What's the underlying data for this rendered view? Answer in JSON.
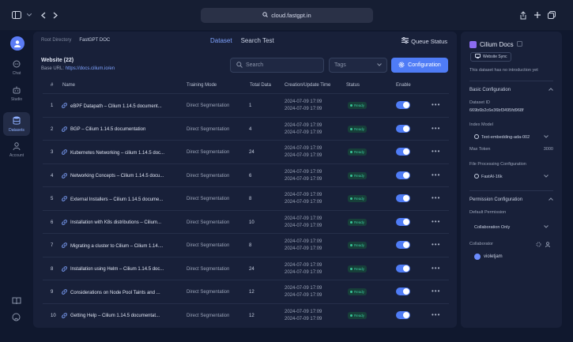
{
  "browser": {
    "url": "cloud.fastgpt.in"
  },
  "nav": {
    "items": [
      {
        "label": "Chat",
        "icon": "chat-icon"
      },
      {
        "label": "Studio",
        "icon": "robot-icon"
      },
      {
        "label": "Datasets",
        "icon": "database-icon"
      },
      {
        "label": "Account",
        "icon": "person-icon"
      }
    ]
  },
  "breadcrumb": {
    "root": "Root Directory",
    "current": "FastGPT DOC"
  },
  "tabs": [
    "Dataset",
    "Search Test"
  ],
  "queue_status": "Queue Status",
  "dataset": {
    "title": "Website (22)",
    "base_url_label": "Base URL:",
    "base_url": "https://docs.cilium.io/en"
  },
  "search": {
    "placeholder": "Search"
  },
  "tags": {
    "placeholder": "Tags"
  },
  "config_button": "Configuration",
  "table": {
    "headers": [
      "#",
      "Name",
      "Training Mode",
      "Total Data",
      "Creation/Update Time",
      "Status",
      "Enable"
    ],
    "status_label": "Ready",
    "rows": [
      {
        "num": "1",
        "name": "eBPF Datapath – Cilium 1.14.5 document...",
        "mode": "Direct Segmentation",
        "total": "1",
        "created": "2024-07-09 17:09",
        "updated": "2024-07-09 17:09"
      },
      {
        "num": "2",
        "name": "BGP – Cilium 1.14.5 documentation",
        "mode": "Direct Segmentation",
        "total": "4",
        "created": "2024-07-09 17:09",
        "updated": "2024-07-09 17:09"
      },
      {
        "num": "3",
        "name": "Kubernetes Networking – cilium 1.14.5 doc...",
        "mode": "Direct Segmentation",
        "total": "24",
        "created": "2024-07-09 17:09",
        "updated": "2024-07-09 17:09"
      },
      {
        "num": "4",
        "name": "Networking Concepts – Cilium 1.14.5 docu...",
        "mode": "Direct Segmentation",
        "total": "6",
        "created": "2024-07-09 17:09",
        "updated": "2024-07-09 17:09"
      },
      {
        "num": "5",
        "name": "External Installers – Cilium 1.14.5 docume...",
        "mode": "Direct Segmentation",
        "total": "8",
        "created": "2024-07-09 17:09",
        "updated": "2024-07-09 17:09"
      },
      {
        "num": "6",
        "name": "Installation with K8s distributions – Cilium...",
        "mode": "Direct Segmentation",
        "total": "10",
        "created": "2024-07-09 17:09",
        "updated": "2024-07-09 17:09"
      },
      {
        "num": "7",
        "name": "Migrating a cluster to Cilium – Cilium 1.14....",
        "mode": "Direct Segmentation",
        "total": "8",
        "created": "2024-07-09 17:09",
        "updated": "2024-07-09 17:09"
      },
      {
        "num": "8",
        "name": "Installation using Helm – Cilium 1.14.5 doc...",
        "mode": "Direct Segmentation",
        "total": "24",
        "created": "2024-07-09 17:09",
        "updated": "2024-07-09 17:09"
      },
      {
        "num": "9",
        "name": "Considerations on Node Pool Taints and ...",
        "mode": "Direct Segmentation",
        "total": "12",
        "created": "2024-07-09 17:09",
        "updated": "2024-07-09 17:09"
      },
      {
        "num": "10",
        "name": "Getting Help – Cilium 1.14.5 documentat...",
        "mode": "Direct Segmentation",
        "total": "12",
        "created": "2024-07-09 17:09",
        "updated": "2024-07-09 17:09"
      }
    ]
  },
  "right": {
    "title": "Cilium Docs",
    "sync_button": "Website Sync",
    "intro": "This dataset has no introduction yet",
    "basic_config": "Basic Configuration",
    "dataset_id_label": "Dataset ID",
    "dataset_id": "669b6b2c6e36bf3495fd968f",
    "index_model_label": "Index Model",
    "index_model": "Text-embedding-ada-002",
    "max_token_label": "Max Token",
    "max_token": "3000",
    "file_proc_label": "File Processing Configuration",
    "file_proc": "FastAI-16k",
    "permission_config": "Permission Configuration",
    "default_permission_label": "Default Permission",
    "default_permission": "Collaboration Only",
    "collaborator_label": "Collaborator",
    "collaborator": "violetjam"
  },
  "colors": {
    "accent": "#4f7cf6",
    "ready": "#37c79a",
    "background": "#10182e",
    "panel": "#182039"
  }
}
